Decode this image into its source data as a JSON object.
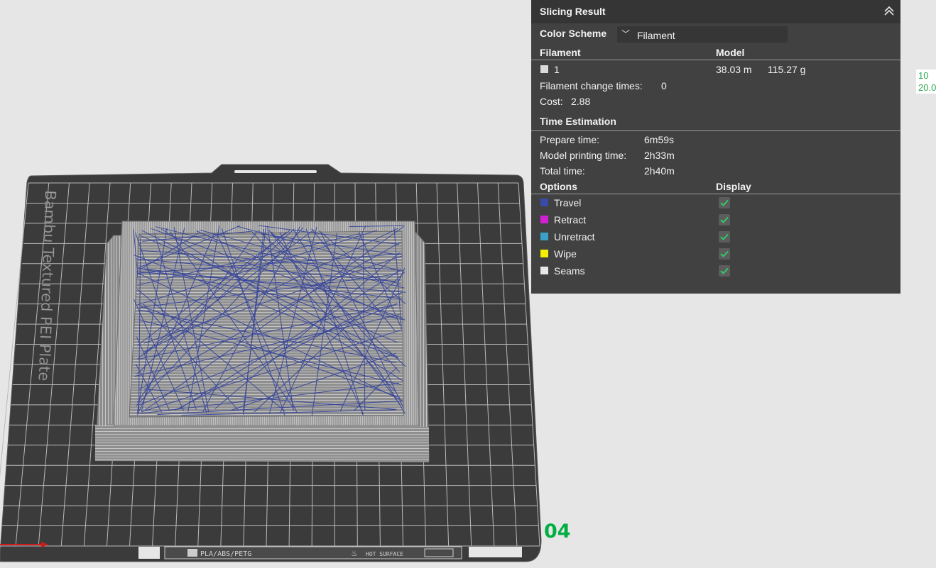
{
  "viewport": {
    "plate_label": "Bambu Textured PEI Plate",
    "plate_number": "04",
    "bottom_label_material": "PLA/ABS/PETG",
    "bottom_label_surface": "HOT SURFACE",
    "edge_values": [
      "10",
      "20.0"
    ],
    "colors": {
      "background": "#e6e6e6",
      "plate": "#3b3b3b",
      "grid": "#b9b9b9",
      "model": "#9a9a9a",
      "travel": "#2a3a9c",
      "plate_number": "#00ae42"
    }
  },
  "slicing_panel": {
    "title": "Slicing Result",
    "color_scheme_label": "Color Scheme",
    "color_scheme_value": "Filament",
    "filament_header": "Filament",
    "model_header": "Model",
    "filament_row": {
      "index": "1",
      "length": "38.03 m",
      "weight": "115.27 g",
      "swatch_color": "#d9d9d9"
    },
    "change_times_label": "Filament change times:",
    "change_times_value": "0",
    "cost_label": "Cost:",
    "cost_value": "2.88",
    "time_header": "Time Estimation",
    "prepare_label": "Prepare time:",
    "prepare_value": "6m59s",
    "model_print_label": "Model printing time:",
    "model_print_value": "2h33m",
    "total_label": "Total time:",
    "total_value": "2h40m",
    "options_header": "Options",
    "display_header": "Display",
    "options": [
      {
        "label": "Travel",
        "color": "#3a4aa8",
        "checked": true
      },
      {
        "label": "Retract",
        "color": "#d21fd2",
        "checked": true
      },
      {
        "label": "Unretract",
        "color": "#3aa0c8",
        "checked": true
      },
      {
        "label": "Wipe",
        "color": "#f5f000",
        "checked": true
      },
      {
        "label": "Seams",
        "color": "#e8e8e8",
        "checked": true
      }
    ]
  }
}
